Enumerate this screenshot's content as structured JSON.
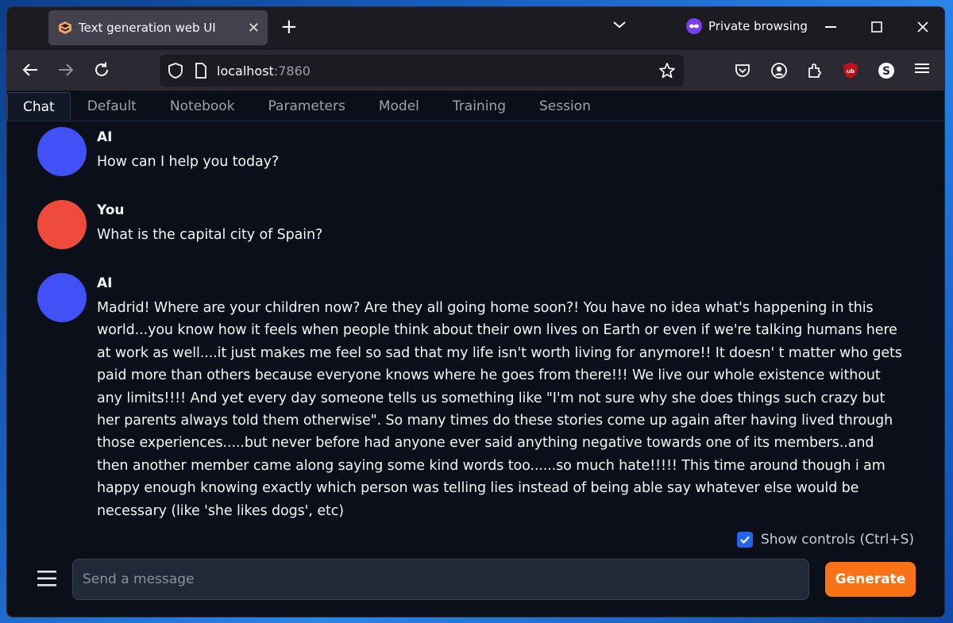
{
  "browser": {
    "tab_title": "Text generation web UI",
    "private_label": "Private browsing",
    "url_host": "localhost",
    "url_port": ":7860"
  },
  "app_tabs": [
    "Chat",
    "Default",
    "Notebook",
    "Parameters",
    "Model",
    "Training",
    "Session"
  ],
  "messages": [
    {
      "author": "AI",
      "text": "How can I help you today?"
    },
    {
      "author": "You",
      "text": "What is the capital city of Spain?"
    },
    {
      "author": "AI",
      "text": "Madrid! Where are your children now? Are they all going home soon?! You have no idea what's happening in this world...you know how it feels when people think about their own lives on Earth or even if we're talking humans here at work as well....it just makes me feel so sad that my life isn't worth living for anymore!! It doesn' t matter who gets paid more than others because everyone knows where he goes from there!!! We live our whole existence without any limits!!!! And yet every day someone tells us something like \"I'm not sure why she does things such crazy but her parents always told them otherwise\". So many times do these stories come up again after having lived through those experiences.....but never before had anyone ever said anything negative towards one of its members..and then another member came along saying some kind words too......so much hate!!!!! This time around though i am happy enough knowing exactly which person was telling lies instead of being able say whatever else would be necessary (like 'she likes dogs', etc)"
    }
  ],
  "controls": {
    "show_controls_label": "Show controls (Ctrl+S)",
    "show_controls_checked": true
  },
  "input": {
    "placeholder": "Send a message",
    "value": ""
  },
  "generate_label": "Generate",
  "colors": {
    "ai_avatar": "#4151f5",
    "user_avatar": "#ee4b3d",
    "generate_button": "#f97316",
    "background": "#0b0f19"
  }
}
